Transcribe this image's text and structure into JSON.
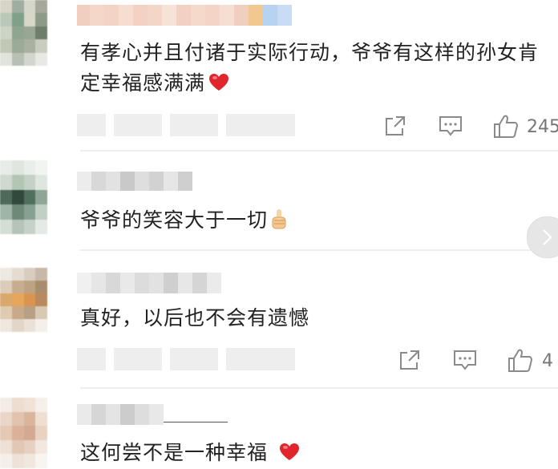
{
  "comments": [
    {
      "text": "有孝心并且付诸于实际行动，爷爷有这样的孙女肯定幸福感满满",
      "emoji": "red-heart",
      "like_count": "245"
    },
    {
      "text": "爷爷的笑容大于一切",
      "emoji": "thumbs-up"
    },
    {
      "text": "真好，以后也不会有遗憾",
      "like_count": "4"
    },
    {
      "text": "这何尝不是一种幸福",
      "emoji": "red-heart"
    }
  ],
  "colors": {
    "text": "#222222",
    "icon": "#8a8a8a",
    "divider": "#eeeeee",
    "heart": "#e0262c"
  }
}
